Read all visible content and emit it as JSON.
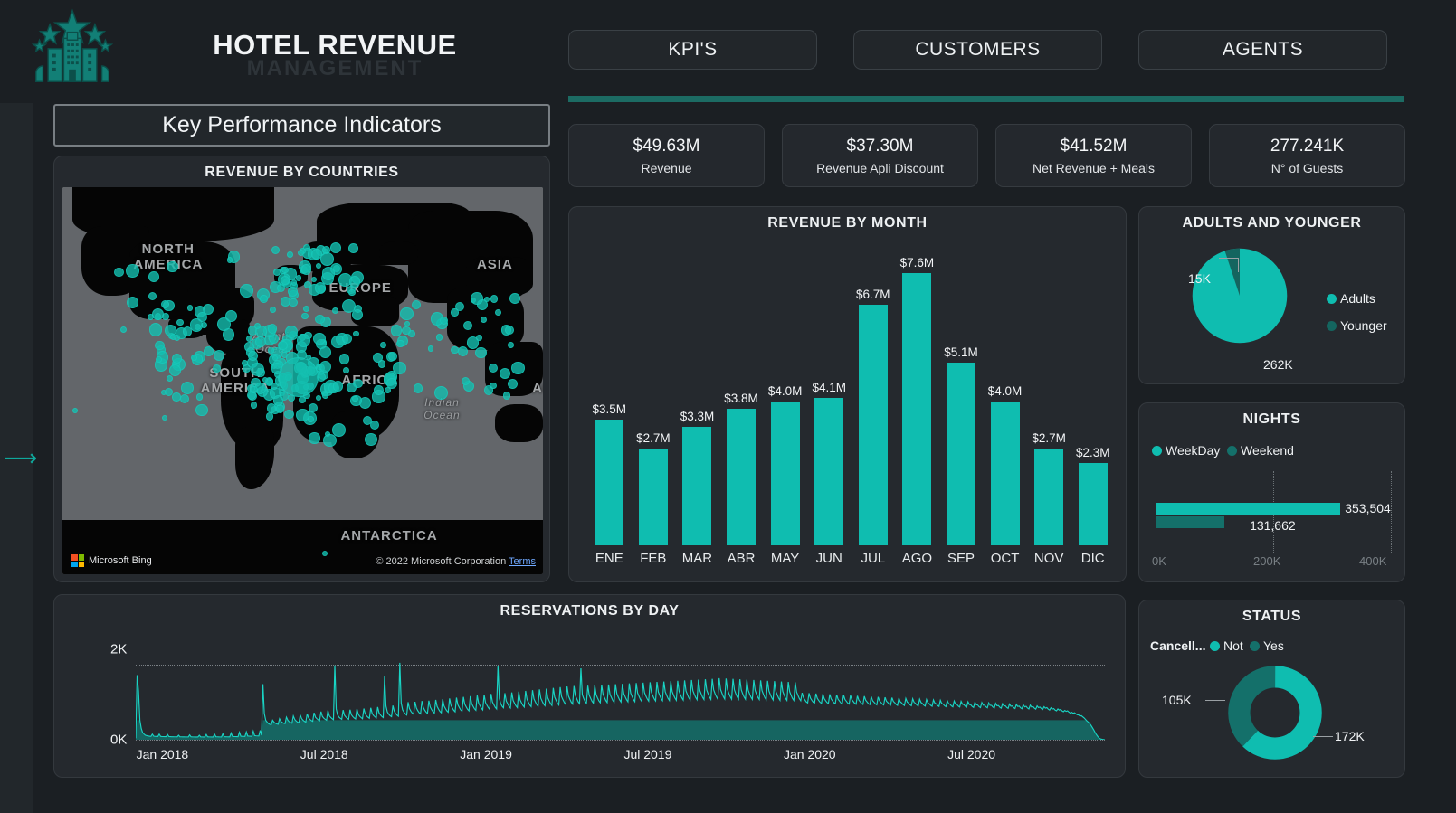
{
  "header": {
    "logo_icon": "hotel-stars-icon",
    "title_main": "HOTEL REVENUE",
    "title_sub": "MANAGEMENT",
    "tabs": [
      {
        "label": "KPI'S"
      },
      {
        "label": "CUSTOMERS"
      },
      {
        "label": "AGENTS"
      }
    ]
  },
  "sidebar": {
    "expand_icon": "arrow-right-icon"
  },
  "left": {
    "section_banner": "Key Performance Indicators",
    "map": {
      "title": "REVENUE BY COUNTRIES",
      "provider": "Microsoft Bing",
      "copyright": "© 2022 Microsoft Corporation",
      "terms_link": "Terms",
      "labels": [
        "NORTH AMERICA",
        "SOUTH AMERICA",
        "EUROPE",
        "ASIA",
        "AFRICA",
        "ANTARCTICA",
        "AUST",
        "Atlantic Ocean",
        "Indian Ocean"
      ]
    }
  },
  "kpi_cards": [
    {
      "value": "$49.63M",
      "label": "Revenue"
    },
    {
      "value": "$37.30M",
      "label": "Revenue Apli Discount"
    },
    {
      "value": "$41.52M",
      "label": "Net Revenue + Meals"
    },
    {
      "value": "277.241K",
      "label": "N° of Guests"
    }
  ],
  "colors": {
    "accent_teal": "#0fbdb0",
    "dark_teal": "#147a72",
    "rule_teal": "#1c6b63",
    "panel_bg": "#25292e",
    "page_bg": "#1b1f23"
  },
  "chart_data": [
    {
      "type": "bar",
      "title": "REVENUE BY MONTH",
      "categories": [
        "ENE",
        "FEB",
        "MAR",
        "ABR",
        "MAY",
        "JUN",
        "JUL",
        "AGO",
        "SEP",
        "OCT",
        "NOV",
        "DIC"
      ],
      "values": [
        3.5,
        2.7,
        3.3,
        3.8,
        4.0,
        4.1,
        6.7,
        7.6,
        5.1,
        4.0,
        2.7,
        2.3
      ],
      "labels": [
        "$3.5M",
        "$2.7M",
        "$3.3M",
        "$3.8M",
        "$4.0M",
        "$4.1M",
        "$6.7M",
        "$7.6M",
        "$5.1M",
        "$4.0M",
        "$2.7M",
        "$2.3M"
      ],
      "xlabel": "",
      "ylabel": "",
      "ylim": [
        0,
        8.3
      ],
      "grid": false,
      "legend": "none"
    },
    {
      "type": "pie",
      "title": "ADULTS AND YOUNGER",
      "categories": [
        "Adults",
        "Younger"
      ],
      "values": [
        262000,
        15000
      ],
      "labels": [
        "262K",
        "15K"
      ],
      "legend": "right",
      "colors": [
        "#0fbdb0",
        "#14655f"
      ]
    },
    {
      "type": "bar",
      "title": "NIGHTS",
      "orientation": "horizontal",
      "categories": [
        "WeekDay",
        "Weekend"
      ],
      "values": [
        353504,
        131662
      ],
      "labels": [
        "353,504",
        "131,662"
      ],
      "xticks": [
        "0K",
        "200K",
        "400K"
      ],
      "xlim": [
        0,
        450000
      ],
      "legend": "top-left",
      "colors": [
        "#0fbdb0",
        "#14706a"
      ]
    },
    {
      "type": "pie",
      "title": "STATUS",
      "legend_title": "Cancell...",
      "categories": [
        "Not",
        "Yes"
      ],
      "values": [
        172000,
        105000
      ],
      "labels": [
        "172K",
        "105K"
      ],
      "donut": true,
      "legend": "top-left",
      "colors": [
        "#0fbdb0",
        "#14706a"
      ]
    },
    {
      "type": "area",
      "title": "RESERVATIONS BY DAY",
      "xticks": [
        "Jan 2018",
        "Jul 2018",
        "Jan 2019",
        "Jul 2019",
        "Jan 2020",
        "Jul 2020"
      ],
      "yticks": [
        "0K",
        "2K"
      ],
      "ylim": [
        0,
        2600
      ],
      "xlabel": "",
      "ylabel": "",
      "series": [
        {
          "name": "Reservations",
          "values": [
            40,
            1720,
            1300,
            520,
            300,
            190,
            150,
            120,
            110,
            100,
            95,
            90,
            150,
            95,
            90,
            88,
            86,
            150,
            90,
            85,
            84,
            83,
            82,
            140,
            85,
            82,
            80,
            80,
            78,
            78,
            77,
            120,
            80,
            78,
            76,
            76,
            75,
            75,
            74,
            130,
            78,
            76,
            75,
            74,
            74,
            73,
            120,
            76,
            75,
            74,
            73,
            140,
            78,
            76,
            75,
            74,
            73,
            150,
            80,
            78,
            76,
            75,
            74,
            160,
            82,
            80,
            78,
            77,
            76,
            180,
            90,
            86,
            84,
            82,
            80,
            200,
            95,
            92,
            90,
            88,
            210,
            100,
            96,
            94,
            92,
            230,
            110,
            105,
            102,
            100,
            250,
            120,
            1480,
            700,
            520,
            470,
            430,
            410,
            400,
            520,
            470,
            440,
            420,
            410,
            560,
            490,
            460,
            440,
            430,
            600,
            520,
            480,
            460,
            440,
            630,
            540,
            500,
            470,
            455,
            660,
            560,
            520,
            490,
            470,
            690,
            580,
            540,
            510,
            490,
            720,
            600,
            560,
            530,
            505,
            750,
            620,
            575,
            545,
            520,
            780,
            640,
            595,
            560,
            535,
            1980,
            820,
            660,
            600,
            570,
            545,
            790,
            650,
            605,
            570,
            545,
            800,
            665,
            615,
            580,
            555,
            820,
            675,
            625,
            590,
            560,
            830,
            690,
            635,
            600,
            570,
            850,
            700,
            645,
            610,
            580,
            870,
            715,
            660,
            620,
            590,
            1700,
            900,
            740,
            680,
            640,
            615,
            910,
            760,
            700,
            655,
            625,
            2050,
            980,
            800,
            735,
            690,
            660,
            1000,
            830,
            760,
            710,
            680,
            1010,
            845,
            775,
            720,
            690,
            1030,
            860,
            790,
            735,
            700,
            1040,
            870,
            800,
            745,
            710,
            1060,
            885,
            815,
            755,
            720,
            1080,
            900,
            830,
            770,
            735,
            1100,
            915,
            845,
            785,
            745,
            1120,
            930,
            860,
            795,
            760,
            1140,
            945,
            875,
            810,
            770,
            1160,
            960,
            890,
            825,
            785,
            1180,
            975,
            905,
            840,
            795,
            1200,
            990,
            920,
            855,
            810,
            1220,
            1005,
            935,
            865,
            820,
            1960,
            1100,
            960,
            890,
            850,
            1240,
            1030,
            960,
            890,
            845,
            1260,
            1045,
            970,
            900,
            855,
            1280,
            1060,
            985,
            915,
            870,
            1300,
            1075,
            1000,
            925,
            880,
            1320,
            1090,
            1010,
            940,
            890,
            1340,
            1105,
            1025,
            950,
            905,
            1360,
            1120,
            1040,
            965,
            915,
            1380,
            1135,
            1050,
            975,
            925,
            1400,
            1150,
            1065,
            990,
            940,
            1420,
            1165,
            1080,
            1000,
            950,
            1430,
            1175,
            1090,
            1010,
            960,
            1900,
            1200,
            1100,
            1020,
            970,
            1440,
            1190,
            1105,
            1025,
            975,
            1450,
            1200,
            1115,
            1035,
            985,
            1460,
            1210,
            1125,
            1045,
            990,
            1470,
            1215,
            1130,
            1050,
            1000,
            1480,
            1225,
            1140,
            1060,
            1005,
            1490,
            1230,
            1145,
            1065,
            1010,
            1500,
            1240,
            1150,
            1070,
            1015,
            1510,
            1245,
            1160,
            1075,
            1020,
            1520,
            1255,
            1165,
            1085,
            1030,
            1530,
            1260,
            1170,
            1090,
            1035,
            1540,
            1270,
            1180,
            1095,
            1040,
            1550,
            1275,
            1185,
            1100,
            1045,
            1560,
            1285,
            1190,
            1110,
            1050,
            1570,
            1290,
            1200,
            1115,
            1055,
            1580,
            1300,
            1205,
            1120,
            1060,
            1590,
            1305,
            1210,
            1125,
            1065,
            1600,
            1315,
            1220,
            1130,
            1070,
            1610,
            1320,
            1225,
            1140,
            1075,
            1620,
            1330,
            1230,
            1145,
            1080,
            1640,
            1340,
            1240,
            1150,
            1085,
            1630,
            1335,
            1235,
            1148,
            1082,
            1620,
            1330,
            1230,
            1145,
            1080,
            1610,
            1325,
            1225,
            1140,
            1078,
            1600,
            1320,
            1220,
            1135,
            1075,
            1590,
            1315,
            1215,
            1130,
            1070,
            1580,
            1305,
            1210,
            1125,
            1065,
            1570,
            1300,
            1205,
            1120,
            1060,
            1560,
            1290,
            1195,
            1110,
            1050,
            1550,
            1285,
            1190,
            1105,
            1048,
            1540,
            1280,
            1185,
            1100,
            1045,
            1530,
            1270,
            1180,
            1095,
            1040,
            1250,
            1120,
            1060,
            1005,
            980,
            1240,
            1110,
            1050,
            1000,
            975,
            1230,
            1100,
            1045,
            995,
            970,
            1220,
            1095,
            1040,
            990,
            965,
            1210,
            1085,
            1035,
            985,
            960,
            1200,
            1080,
            1030,
            980,
            955,
            1190,
            1070,
            1025,
            975,
            950,
            1180,
            1065,
            1020,
            970,
            945,
            1170,
            1055,
            1010,
            965,
            940,
            1160,
            1050,
            1005,
            960,
            935,
            1150,
            1040,
            1000,
            955,
            930,
            1140,
            1035,
            995,
            950,
            925,
            1130,
            1025,
            990,
            945,
            920,
            1120,
            1020,
            985,
            940,
            915,
            1110,
            1010,
            980,
            935,
            910,
            1100,
            1005,
            975,
            930,
            905,
            1090,
            995,
            970,
            925,
            900,
            1080,
            990,
            965,
            920,
            895,
            1070,
            980,
            960,
            915,
            890,
            1060,
            975,
            955,
            910,
            885,
            1050,
            965,
            950,
            905,
            880,
            1040,
            960,
            945,
            900,
            875,
            1030,
            950,
            940,
            895,
            870,
            1020,
            945,
            935,
            890,
            865,
            1010,
            935,
            930,
            885,
            860,
            1000,
            930,
            925,
            880,
            855,
            990,
            920,
            920,
            875,
            850,
            980,
            915,
            915,
            870,
            845,
            970,
            905,
            910,
            865,
            840,
            960,
            900,
            905,
            860,
            835,
            950,
            890,
            900,
            855,
            830,
            940,
            885,
            895,
            850,
            825,
            930,
            875,
            890,
            845,
            820,
            920,
            870,
            885,
            840,
            815,
            900,
            855,
            870,
            830,
            805,
            880,
            840,
            855,
            815,
            790,
            850,
            815,
            830,
            790,
            770,
            820,
            790,
            805,
            770,
            745,
            780,
            755,
            770,
            735,
            710,
            730,
            705,
            720,
            690,
            665,
            660,
            630,
            640,
            610,
            580,
            540,
            500,
            470,
            430,
            380,
            320,
            260,
            190,
            130,
            80,
            40,
            20,
            10,
            5,
            0
          ]
        }
      ]
    }
  ]
}
